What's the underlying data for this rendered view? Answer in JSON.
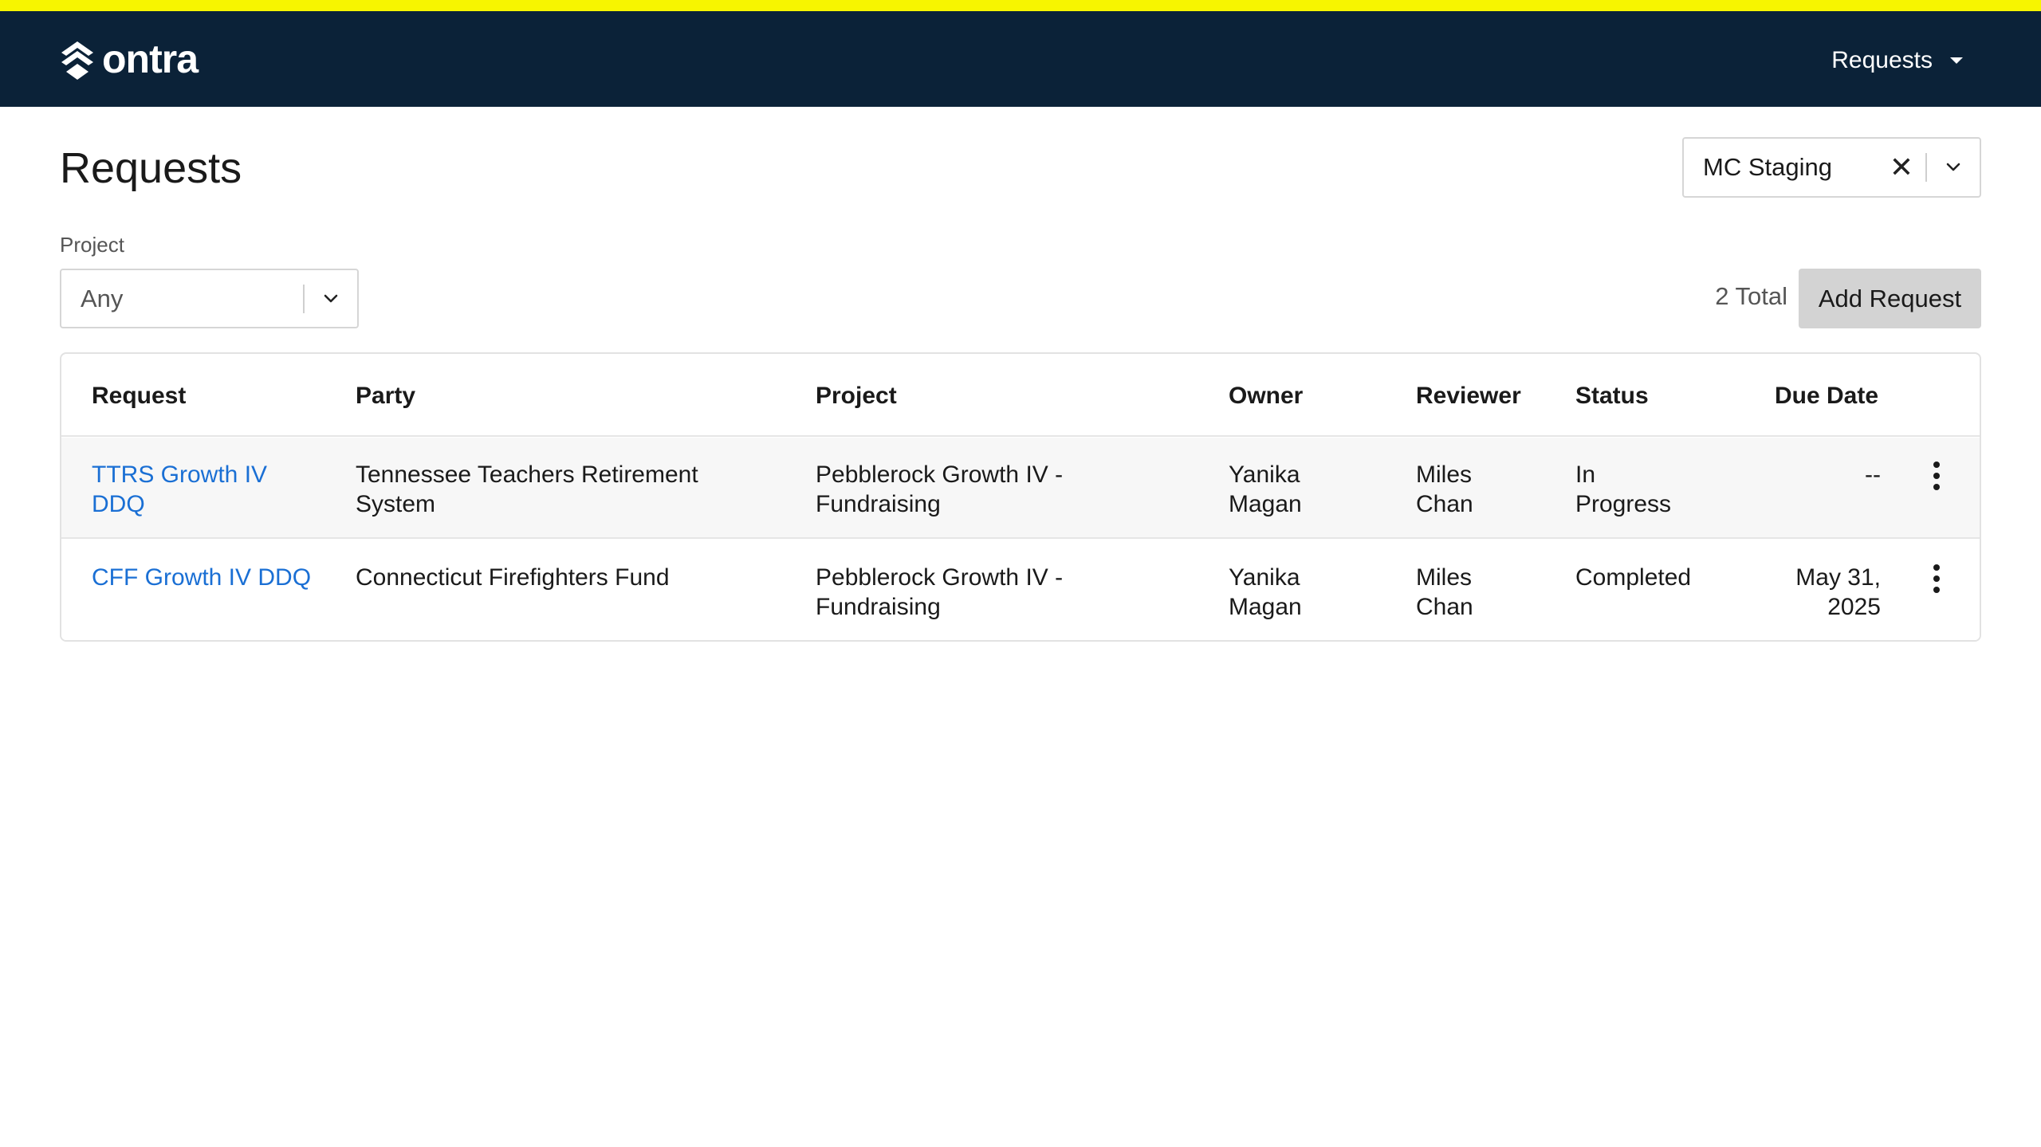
{
  "brand": {
    "name": "ontra"
  },
  "nav": {
    "menu_label": "Requests"
  },
  "page": {
    "title": "Requests"
  },
  "environment": {
    "selected": "MC Staging",
    "clear_symbol": "✕"
  },
  "filters": {
    "project_label": "Project",
    "project_value": "Any"
  },
  "summary": {
    "total": "2 Total",
    "add_button": "Add Request"
  },
  "table": {
    "headers": {
      "request": "Request",
      "party": "Party",
      "project": "Project",
      "owner": "Owner",
      "reviewer": "Reviewer",
      "status": "Status",
      "due_date": "Due Date"
    },
    "rows": [
      {
        "request": [
          "TTRS Growth IV",
          "DDQ"
        ],
        "party": [
          "Tennessee Teachers Retirement",
          "System"
        ],
        "project": [
          "Pebblerock Growth IV -",
          "Fundraising"
        ],
        "owner": [
          "Yanika",
          "Magan"
        ],
        "reviewer": [
          "Miles",
          "Chan"
        ],
        "status": [
          "In",
          "Progress"
        ],
        "due_date": [
          "--",
          ""
        ]
      },
      {
        "request": [
          "CFF Growth IV DDQ",
          ""
        ],
        "party": [
          "Connecticut Firefighters Fund",
          ""
        ],
        "project": [
          "Pebblerock Growth IV -",
          "Fundraising"
        ],
        "owner": [
          "Yanika",
          "Magan"
        ],
        "reviewer": [
          "Miles",
          "Chan"
        ],
        "status": [
          "Completed",
          ""
        ],
        "due_date": [
          "May 31,",
          "2025"
        ]
      }
    ]
  },
  "colors": {
    "env_strip": "#f7f500",
    "navbar": "#0b2238",
    "link": "#1a6fd4",
    "button_bg": "#d3d3d3"
  }
}
